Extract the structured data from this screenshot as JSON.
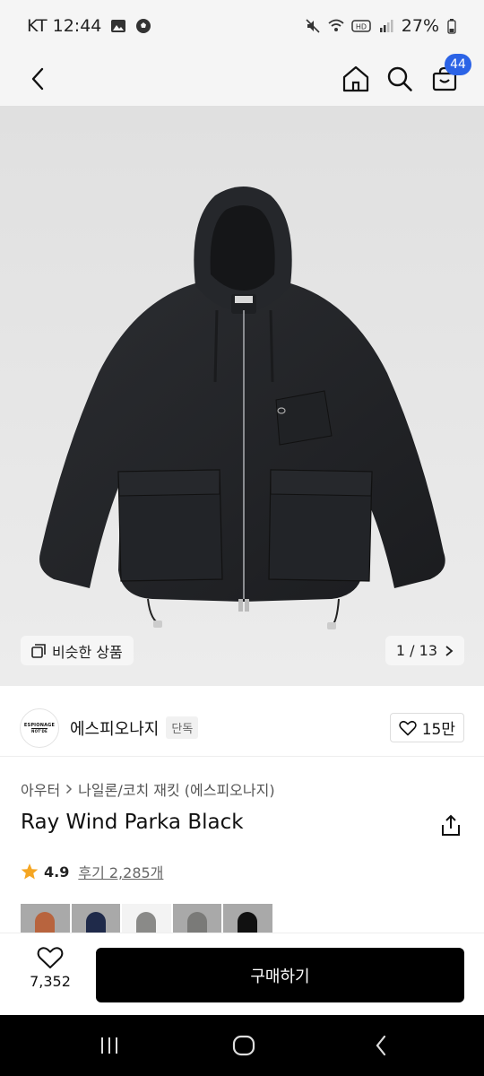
{
  "status_bar": {
    "carrier_time": "KT 12:44",
    "battery": "27%"
  },
  "header": {
    "cart_badge": "44"
  },
  "gallery": {
    "similar_label": "비슷한 상품",
    "pager": "1 / 13"
  },
  "brand": {
    "logo_line1": "ESPIONAGE",
    "logo_line2": "NOT'DE",
    "name": "에스피오나지",
    "tag": "단독",
    "likes": "15만"
  },
  "product": {
    "breadcrumb": [
      "아우터",
      "나일론/코치 재킷 (에스피오나지)"
    ],
    "title": "Ray Wind Parka Black",
    "rating": "4.9",
    "review_label": "후기 2,285개"
  },
  "color_thumbs": [
    "orange",
    "navy",
    "grey-selected",
    "grey",
    "black"
  ],
  "bottom": {
    "wish_count": "7,352",
    "buy_label": "구매하기"
  },
  "colors": {
    "accent": "#2b63e6",
    "star": "#f5a623",
    "button": "#000000"
  }
}
